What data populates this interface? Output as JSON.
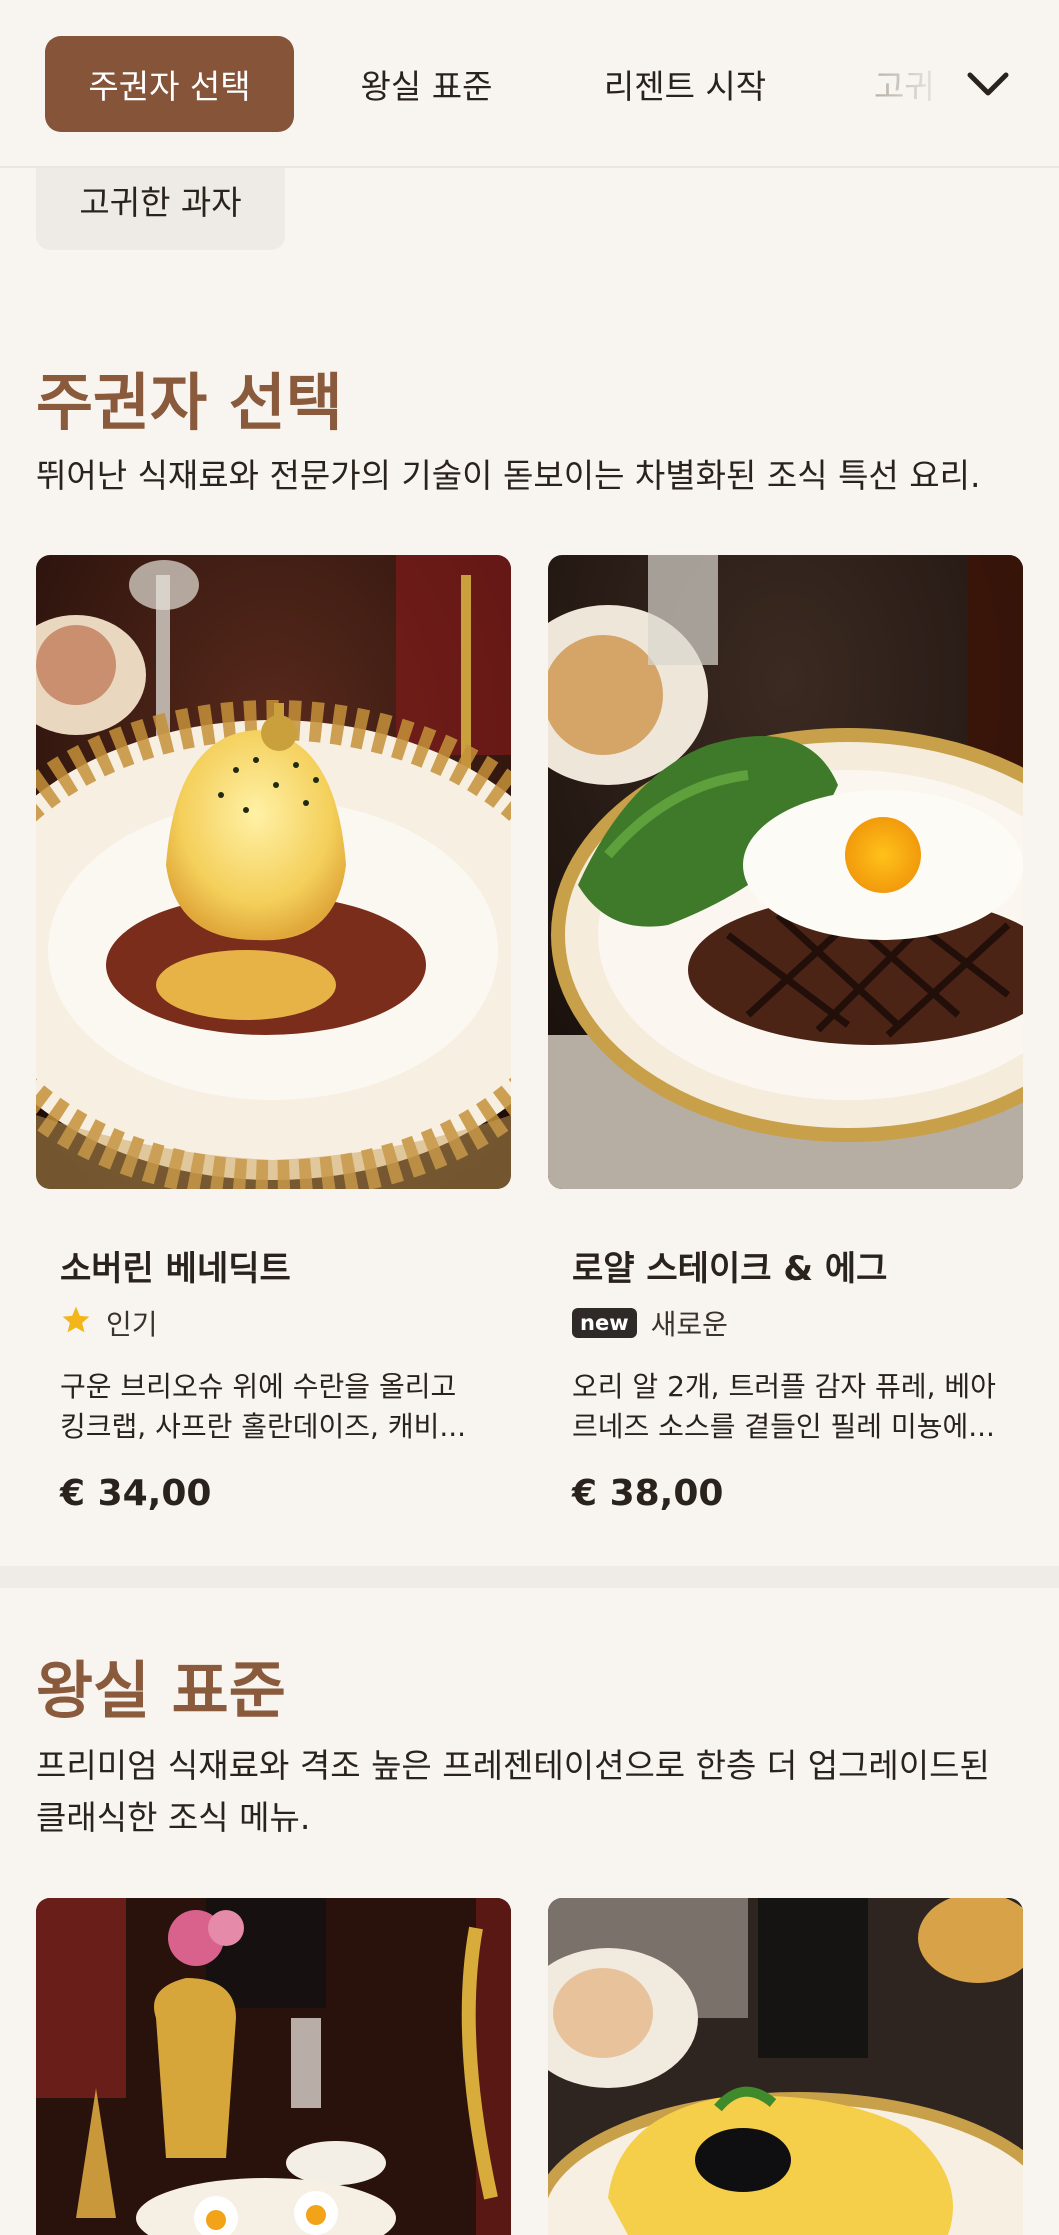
{
  "nav": {
    "tabs": [
      {
        "label": "주권자 선택",
        "active": true
      },
      {
        "label": "왕실 표준",
        "active": false
      },
      {
        "label": "리젠트 시작",
        "active": false
      },
      {
        "label": "고귀",
        "active": false
      }
    ],
    "expand_icon": "chevron-down-icon",
    "overflow_chip": "고귀한 과자"
  },
  "sections": [
    {
      "title": "주권자 선택",
      "description": "뛰어난 식재료와 전문가의 기술이 돋보이는 차별화된 조식 특선 요리.",
      "items": [
        {
          "name": "소버린 베네딕트",
          "badge_icon": "star-icon",
          "badge": "인기",
          "description_lines": [
            "구운 브리오슈 위에 수란을 올리고",
            "킹크랩, 사프란 홀란데이즈, 캐비..."
          ],
          "price": "€ 34,00"
        },
        {
          "name": "로얄 스테이크 & 에그",
          "badge_pill": "new",
          "badge": "새로운",
          "description_lines": [
            "오리 알 2개, 트러플 감자 퓨레, 베아",
            "르네즈 소스를 곁들인 필레 미뇽에..."
          ],
          "price": "€ 38,00"
        }
      ]
    },
    {
      "title": "왕실 표준",
      "description_lines": [
        "프리미엄 식재료와 격조 높은 프레젠테이션으로 한층 더 업그레이드된",
        "클래식한 조식 메뉴."
      ]
    }
  ],
  "colors": {
    "accent": "#855439",
    "title": "#8a5a3c",
    "background": "#f8f5f1",
    "star": "#f2b51a"
  }
}
